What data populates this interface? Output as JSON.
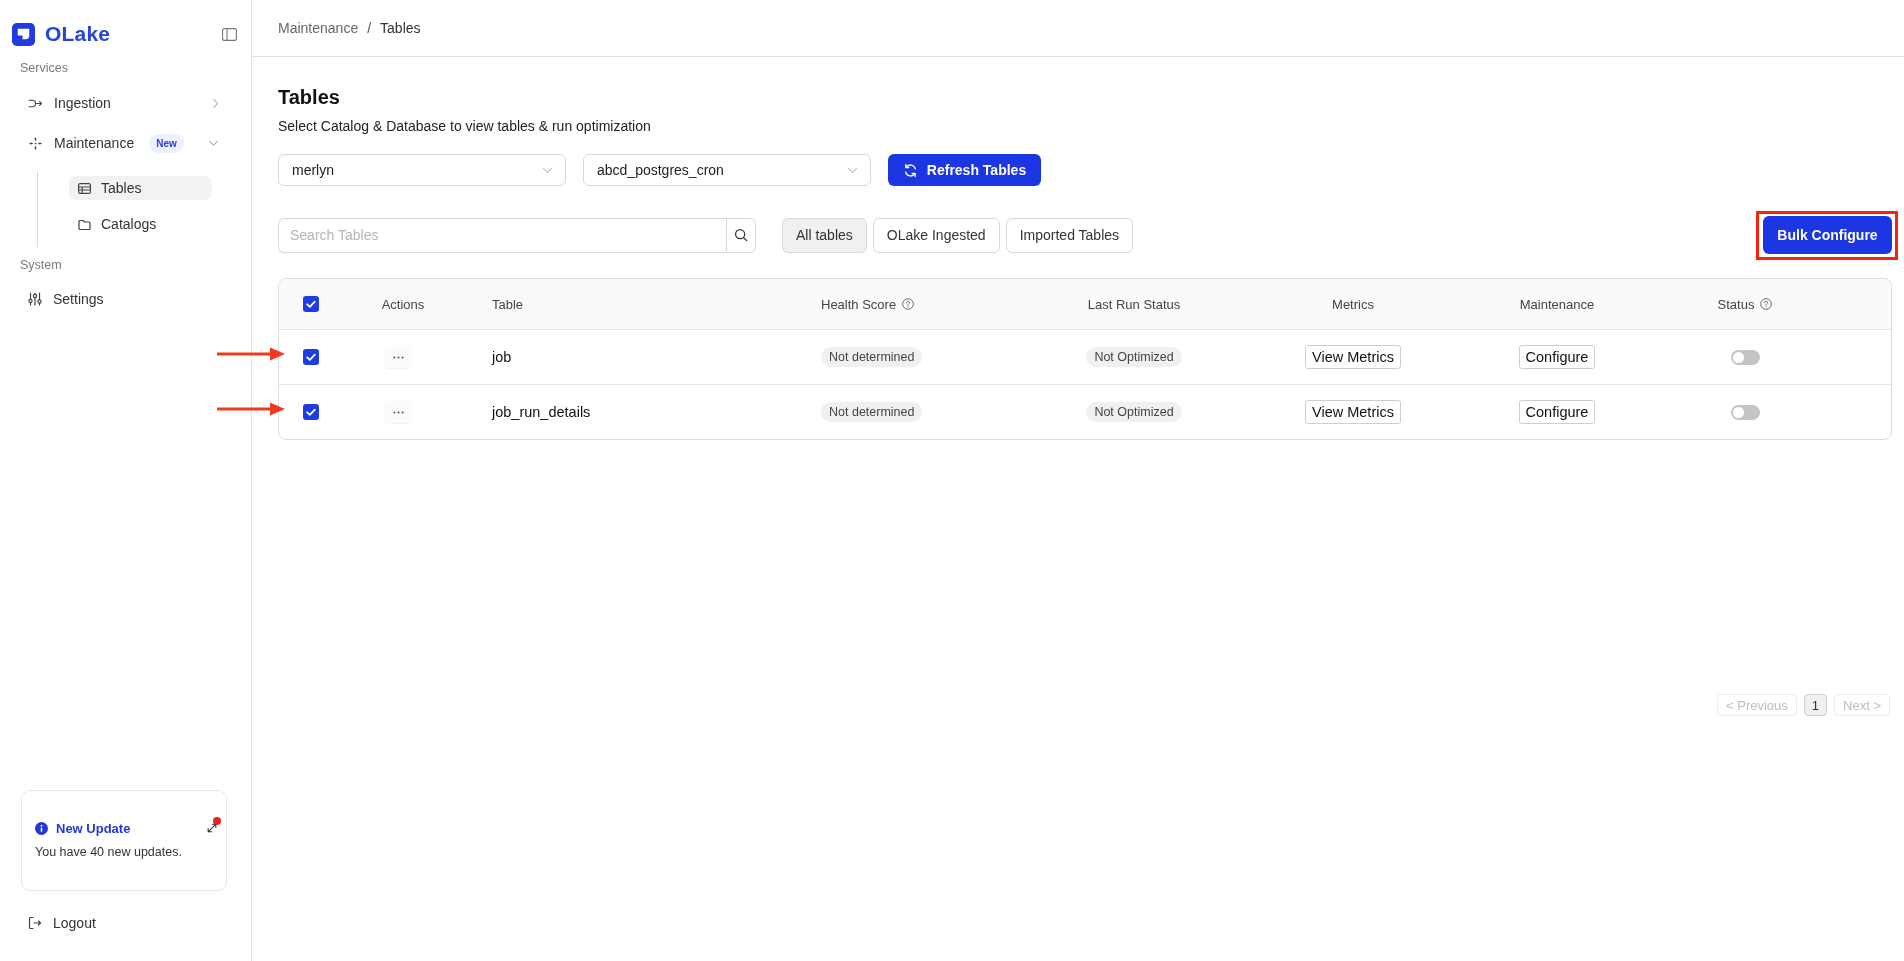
{
  "sidebar": {
    "brand": {
      "name": "OLake"
    },
    "sections": [
      {
        "title": "Services",
        "items": [
          {
            "label": "Ingestion",
            "selected": false,
            "expanded": false
          },
          {
            "label": "Maintenance",
            "badge": "New",
            "selected": false,
            "expanded": true,
            "children": [
              {
                "label": "Tables",
                "selected": true
              },
              {
                "label": "Catalogs",
                "selected": false
              }
            ]
          }
        ]
      },
      {
        "title": "System",
        "items": [
          {
            "label": "Settings",
            "selected": false
          }
        ]
      }
    ],
    "update_card": {
      "title": "New Update",
      "message": "You have 40 new updates.",
      "unread": true
    },
    "logout": {
      "label": "Logout"
    }
  },
  "breadcrumb": {
    "items": [
      "Maintenance",
      "Tables"
    ],
    "separator": "/"
  },
  "page": {
    "title": "Tables",
    "subtitle": "Select Catalog & Database to view tables & run optimization"
  },
  "selectors": [
    {
      "value": "merlyn"
    },
    {
      "value": "abcd_postgres_cron"
    }
  ],
  "refresh_button": {
    "label": "Refresh Tables"
  },
  "search": {
    "placeholder": "Search Tables"
  },
  "filters": [
    {
      "label": "All tables",
      "selected": true
    },
    {
      "label": "OLake Ingested",
      "selected": false
    },
    {
      "label": "Imported Tables",
      "selected": false
    }
  ],
  "bulk_button": {
    "label": "Bulk Configure",
    "highlighted": true
  },
  "table": {
    "select_all": {
      "checked": true
    },
    "columns": [
      {
        "label": "Actions"
      },
      {
        "label": "Table"
      },
      {
        "label": "Health Score",
        "help": true
      },
      {
        "label": "Last Run Status"
      },
      {
        "label": "Metrics"
      },
      {
        "label": "Maintenance"
      },
      {
        "label": "Status",
        "help": true
      }
    ],
    "rows": [
      {
        "checked": true,
        "table": "job",
        "health_score": "Not determined",
        "last_run_status": "Not Optimized",
        "metrics": "View Metrics",
        "maintenance": "Configure",
        "on": false,
        "arrow_marker": true
      },
      {
        "checked": true,
        "table": "job_run_details",
        "health_score": "Not determined",
        "last_run_status": "Not Optimized",
        "metrics": "View Metrics",
        "maintenance": "Configure",
        "on": false,
        "arrow_marker": true
      }
    ]
  },
  "pagination": {
    "previous": {
      "label": "< Previous",
      "disabled": true
    },
    "pages": [
      {
        "label": "1",
        "selected": true
      }
    ],
    "next": {
      "label": "Next >",
      "disabled": true
    }
  }
}
